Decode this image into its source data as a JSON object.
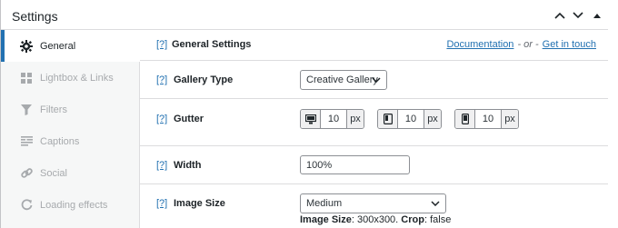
{
  "panel": {
    "title": "Settings"
  },
  "sidebar": {
    "items": [
      {
        "label": "General",
        "icon": "gear-icon",
        "active": true
      },
      {
        "label": "Lightbox & Links",
        "icon": "grid-icon",
        "active": false
      },
      {
        "label": "Filters",
        "icon": "filter-icon",
        "active": false
      },
      {
        "label": "Captions",
        "icon": "captions-icon",
        "active": false
      },
      {
        "label": "Social",
        "icon": "link-icon",
        "active": false
      },
      {
        "label": "Loading effects",
        "icon": "refresh-icon",
        "active": false
      }
    ]
  },
  "content": {
    "section": {
      "help": "[?]",
      "title": "General Settings",
      "documentation": "Documentation",
      "separator": "- or -",
      "get_in_touch": "Get in touch"
    },
    "gallery_type": {
      "help": "[?]",
      "label": "Gallery Type",
      "value": "Creative Gallery"
    },
    "gutter": {
      "help": "[?]",
      "label": "Gutter",
      "fields": [
        {
          "device": "desktop-icon",
          "value": "10",
          "unit": "px"
        },
        {
          "device": "tablet-icon",
          "value": "10",
          "unit": "px"
        },
        {
          "device": "mobile-icon",
          "value": "10",
          "unit": "px"
        }
      ]
    },
    "width": {
      "help": "[?]",
      "label": "Width",
      "value": "100%"
    },
    "image_size": {
      "help": "[?]",
      "label": "Image Size",
      "value": "Medium",
      "desc_size_label": "Image Size",
      "desc_size_value": ": 300x300.",
      "desc_crop_label": "Crop",
      "desc_crop_value": ": false"
    }
  },
  "colors": {
    "accent": "#2271b1",
    "border": "#dcdcde",
    "sidebar_bg": "#f6f7f7"
  }
}
